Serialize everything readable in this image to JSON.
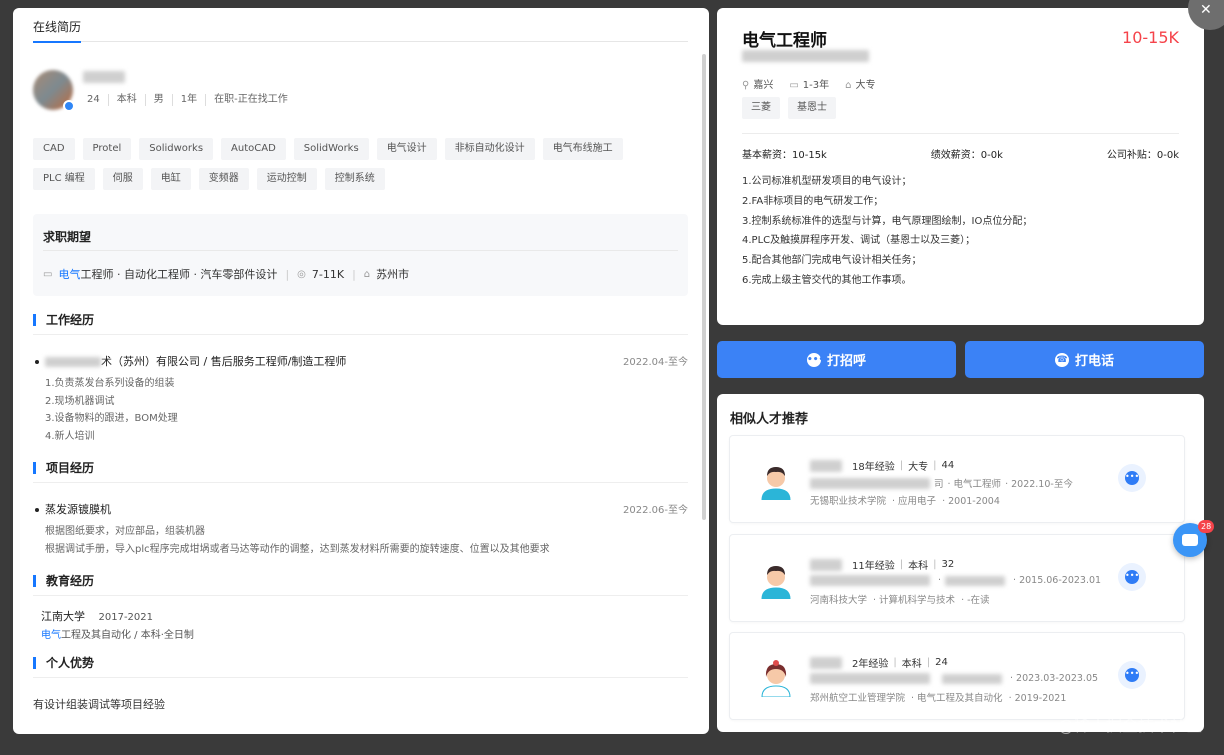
{
  "resume": {
    "tab_label": "在线简历",
    "profile_meta": [
      "24",
      "本科",
      "男",
      "1年",
      "在职-正在找工作"
    ],
    "skills": [
      "CAD",
      "Protel",
      "Solidworks",
      "AutoCAD",
      "SolidWorks",
      "电气设计",
      "非标自动化设计",
      "电气布线施工",
      "PLC 编程",
      "伺服",
      "电缸",
      "变频器",
      "运动控制",
      "控制系统"
    ],
    "expectation": {
      "title": "求职期望",
      "role_highlight": "电气",
      "role_rest": "工程师 · 自动化工程师 · 汽车零部件设计",
      "salary": "7-11K",
      "city": "苏州市"
    },
    "work": {
      "title": "工作经历",
      "company_visible": "术（苏州）有限公司 / 售后服务工程师/制造工程师",
      "date": "2022.04-至今",
      "duties": [
        "1.负责蒸发台系列设备的组装",
        "2.现场机器调试",
        "3.设备物料的跟进，BOM处理",
        "4.新人培训"
      ]
    },
    "project": {
      "title": "项目经历",
      "name": "蒸发源镀膜机",
      "date": "2022.06-至今",
      "details": [
        "根据图纸要求，对应部品，组装机器",
        "根据调试手册，导入plc程序完成坩埚或者马达等动作的调整，达到蒸发材料所需要的旋转速度、位置以及其他要求"
      ]
    },
    "education": {
      "title": "教育经历",
      "school": "江南大学",
      "years": "2017-2021",
      "major_highlight": "电气",
      "major_rest": "工程及其自动化 / 本科·全日制"
    },
    "advantage": {
      "title": "个人优势",
      "text": "有设计组装调试等项目经验"
    }
  },
  "job": {
    "title": "电气工程师",
    "salary": "10-15K",
    "location": "嘉兴",
    "experience": "1-3年",
    "degree": "大专",
    "tags": [
      "三菱",
      "基恩士"
    ],
    "base_pay": "基本薪资：10-15k",
    "perf_pay": "绩效薪资：0-0k",
    "subsidy": "公司补贴：0-0k",
    "duties": [
      "1.公司标准机型研发项目的电气设计；",
      "2.FA非标项目的电气研发工作；",
      "3.控制系统标准件的选型与计算，电气原理图绘制，IO点位分配；",
      "4.PLC及触摸屏程序开发、调试（基恩士以及三菱）；",
      "5.配合其他部门完成电气设计相关任务；",
      "6.完成上级主管交代的其他工作事项。"
    ]
  },
  "actions": {
    "greet": "打招呼",
    "call": "打电话"
  },
  "similar": {
    "title": "相似人才推荐",
    "candidates": [
      {
        "exp": "18年经验",
        "degree": "大专",
        "age": "44",
        "line2_a": "司",
        "line2_b": "· 电气工程师",
        "line2_c": "· 2022.10-至今",
        "school": "无锡职业技术学院",
        "major": "· 应用电子",
        "years": "· 2001-2004",
        "gender": "male"
      },
      {
        "exp": "11年经验",
        "degree": "本科",
        "age": "32",
        "line2_a": "",
        "line2_b": "·",
        "line2_c": "· 2015.06-2023.01",
        "school": "河南科技大学",
        "major": "· 计算机科学与技术",
        "years": "· -在读",
        "gender": "male"
      },
      {
        "exp": "2年经验",
        "degree": "本科",
        "age": "24",
        "line2_a": "",
        "line2_b": "",
        "line2_c": "· 2023.03-2023.05",
        "school": "郑州航空工业管理学院",
        "major": "· 电气工程及其自动化",
        "years": "· 2019-2021",
        "gender": "female"
      }
    ]
  },
  "float_badge": "28",
  "watermark": "@稀土掘金技术社区",
  "colors": {
    "accent": "#1677ff",
    "salary": "#f5434a",
    "button": "#3b82f6"
  }
}
